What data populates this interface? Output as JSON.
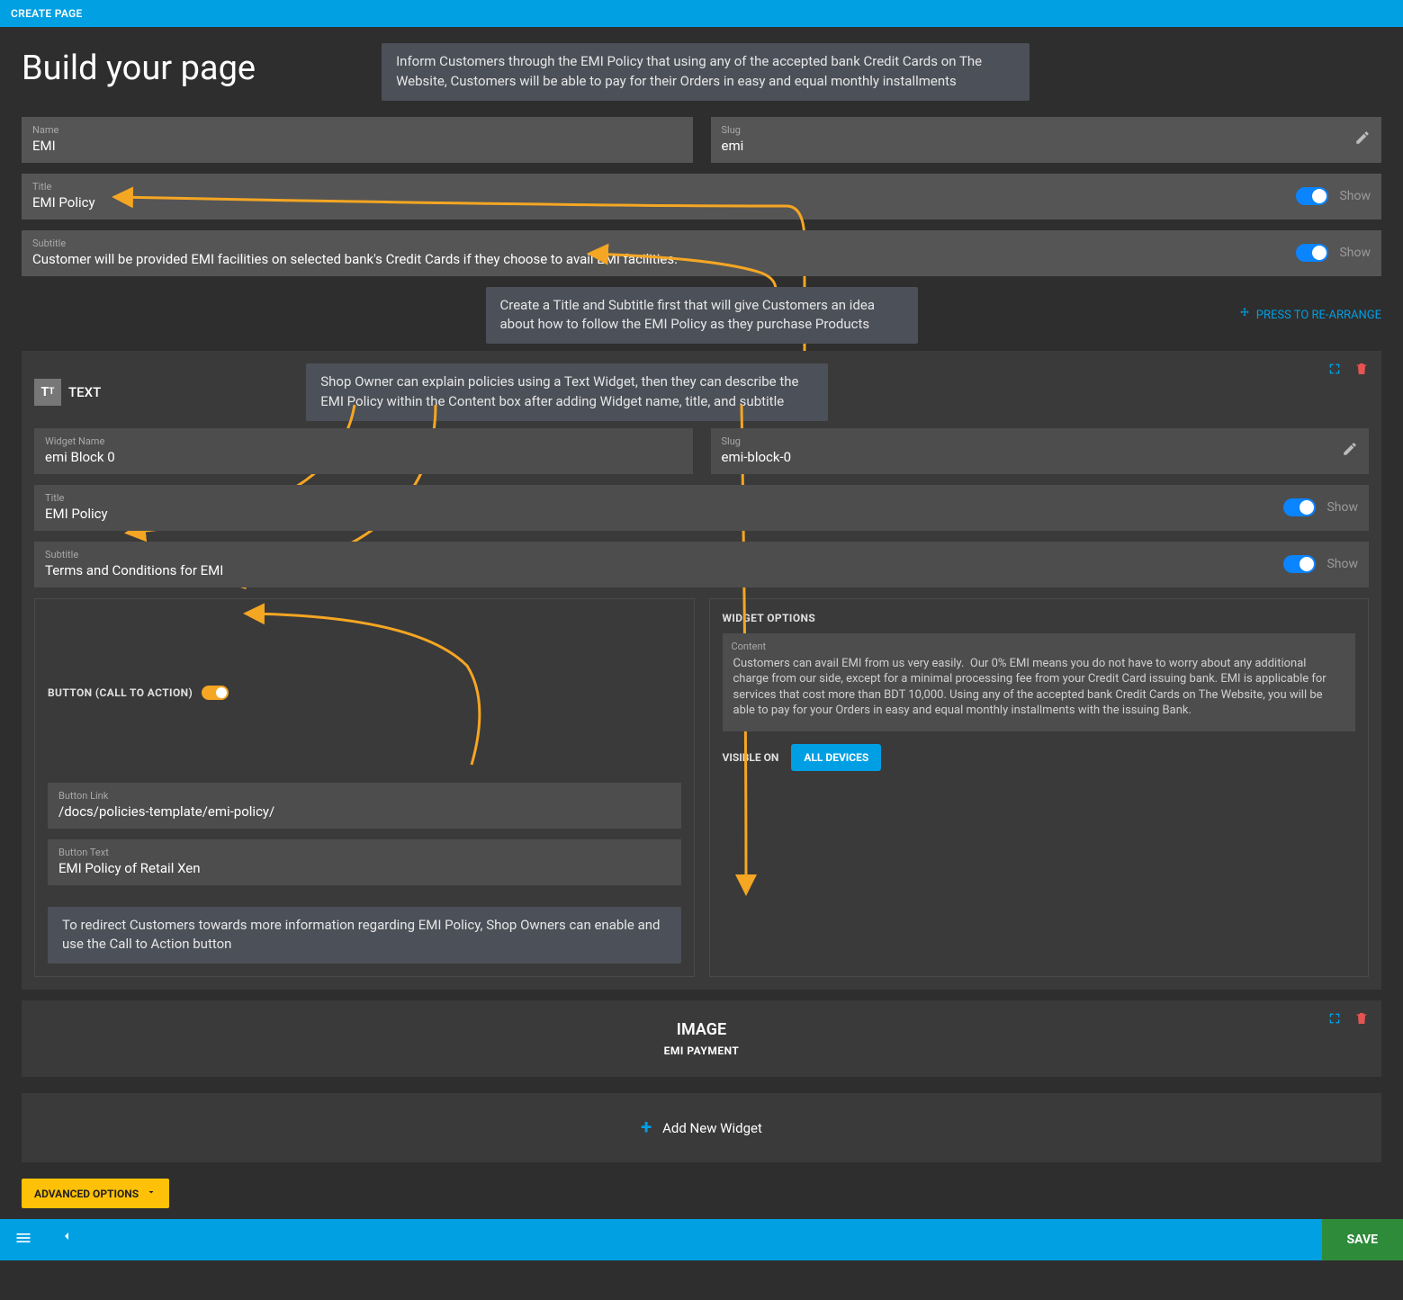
{
  "top_banner": "CREATE PAGE",
  "page_title": "Build your page",
  "callouts": {
    "top": "Inform Customers through the EMI Policy that using any of the accepted bank Credit Cards on The Website, Customers will be able to pay for their Orders in easy and equal monthly installments",
    "mid": "Create a Title and Subtitle first that will give Customers an idea about how to follow the EMI Policy as they purchase Products",
    "widget": "Shop Owner can explain policies using a Text Widget, then they can describe the EMI Policy within the Content box after adding Widget name, title, and subtitle",
    "cta": "To redirect Customers towards more information regarding EMI Policy, Shop Owners can enable and use the Call to Action button"
  },
  "page": {
    "name_label": "Name",
    "name_value": "EMI",
    "slug_label": "Slug",
    "slug_value": "emi",
    "title_label": "Title",
    "title_value": "EMI Policy",
    "subtitle_label": "Subtitle",
    "subtitle_value": "Customer will be provided EMI facilities on selected bank's Credit Cards if they choose to avail EMI facilities.",
    "show_label": "Show"
  },
  "rearrange": "PRESS TO RE-ARRANGE",
  "text_widget": {
    "type": "TEXT",
    "name_label": "Widget Name",
    "name_value": "emi Block 0",
    "slug_label": "Slug",
    "slug_value": "emi-block-0",
    "title_label": "Title",
    "title_value": "EMI Policy",
    "subtitle_label": "Subtitle",
    "subtitle_value": "Terms and Conditions for EMI",
    "show_label": "Show",
    "cta_header": "BUTTON (CALL TO ACTION)",
    "button_link_label": "Button Link",
    "button_link_value": "/docs/policies-template/emi-policy/",
    "button_text_label": "Button Text",
    "button_text_value": "EMI Policy of Retail Xen",
    "options_header": "WIDGET OPTIONS",
    "content_label": "Content",
    "content_value": "Customers can avail EMI from us very easily.  Our 0% EMI means you do not have to worry about any additional charge from our side, except for a minimal processing fee from your Credit Card issuing bank. EMI is applicable for services that cost more than BDT 10,000. Using any of the accepted bank Credit Cards on The Website, you will be able to pay for your Orders in easy and equal monthly installments with the issuing Bank.",
    "visible_on_label": "VISIBLE ON",
    "visible_on_value": "ALL DEVICES"
  },
  "image_widget": {
    "title": "IMAGE",
    "subtitle": "EMI PAYMENT"
  },
  "add_widget": "Add New Widget",
  "advanced_options": "ADVANCED OPTIONS",
  "save": "SAVE"
}
